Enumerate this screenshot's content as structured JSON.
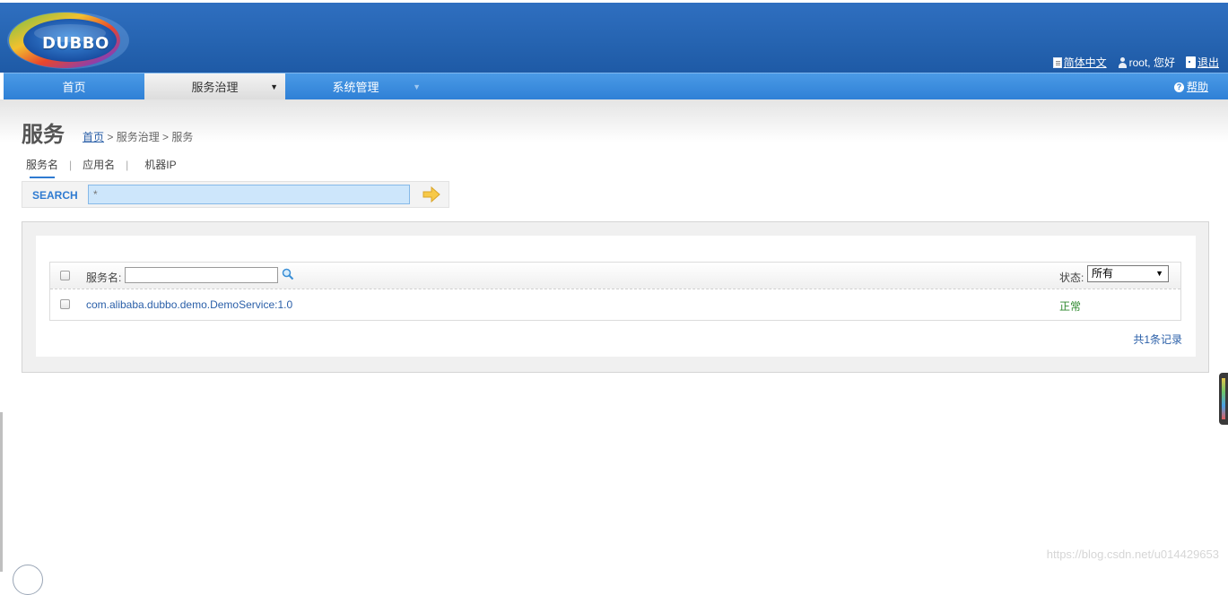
{
  "header": {
    "logo_text": "DUBBO",
    "links": {
      "language": "简体中文",
      "user": "root, 您好",
      "logout": "退出"
    }
  },
  "nav": {
    "items": [
      {
        "label": "首页"
      },
      {
        "label": "服务治理",
        "arrow": "▼"
      },
      {
        "label": "系统管理",
        "arrow": "▼"
      }
    ],
    "help": "帮助"
  },
  "page": {
    "title": "服务",
    "breadcrumb": {
      "home": "首页",
      "rest": " > 服务治理 > 服务"
    }
  },
  "search": {
    "tabs": [
      {
        "label": "服务名",
        "active": true
      },
      {
        "label": "应用名",
        "active": false
      },
      {
        "label": "机器IP",
        "active": false
      }
    ],
    "separator": "|",
    "label": "SEARCH",
    "value": "*"
  },
  "table": {
    "header": {
      "name_label": "服务名:",
      "status_label": "状态:",
      "status_selected": "所有",
      "select_arrow": "▼"
    },
    "rows": [
      {
        "service": "com.alibaba.dubbo.demo.DemoService:1.0",
        "status": "正常"
      }
    ],
    "total": "共1条记录"
  },
  "watermark": "https://blog.csdn.net/u014429653",
  "colors": {
    "header_blue": "#2563b0",
    "nav_blue": "#2f80d6",
    "link_blue": "#2a5fa8",
    "status_green": "#2f8a2f"
  }
}
